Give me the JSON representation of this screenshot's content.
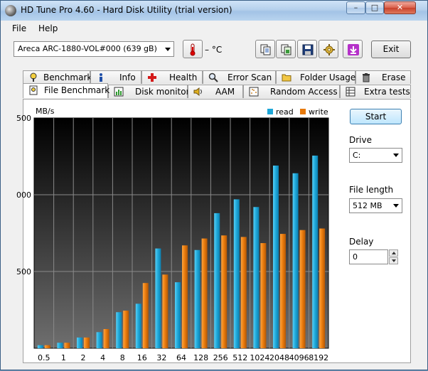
{
  "window": {
    "title": "HD Tune Pro 4.60 - Hard Disk Utility (trial version)",
    "controls": {
      "minimize": "–",
      "maximize": "□",
      "close": "✕"
    }
  },
  "menu": {
    "file": "File",
    "help": "Help"
  },
  "toolbar": {
    "drive_selected": "Areca   ARC-1880-VOL#000 (639 gB)",
    "temperature": "– °C",
    "exit_label": "Exit",
    "icons": [
      "thermometer-icon",
      "copy-text-icon",
      "copy-screenshot-icon",
      "save-icon",
      "options-icon",
      "download-icon"
    ]
  },
  "tabs": {
    "row1": [
      {
        "label": "Benchmark",
        "icon": "benchmark-icon"
      },
      {
        "label": "Info",
        "icon": "info-icon"
      },
      {
        "label": "Health",
        "icon": "health-icon"
      },
      {
        "label": "Error Scan",
        "icon": "error-scan-icon"
      },
      {
        "label": "Folder Usage",
        "icon": "folder-icon"
      },
      {
        "label": "Erase",
        "icon": "erase-icon"
      }
    ],
    "row2": [
      {
        "label": "File Benchmark",
        "icon": "file-benchmark-icon",
        "active": true
      },
      {
        "label": "Disk monitor",
        "icon": "disk-monitor-icon"
      },
      {
        "label": "AAM",
        "icon": "speaker-icon"
      },
      {
        "label": "Random Access",
        "icon": "random-access-icon"
      },
      {
        "label": "Extra tests",
        "icon": "extra-tests-icon"
      }
    ]
  },
  "side": {
    "start_label": "Start",
    "drive_label": "Drive",
    "drive_value": "C:",
    "file_length_label": "File length",
    "file_length_value": "512 MB",
    "delay_label": "Delay",
    "delay_value": "0"
  },
  "chart_data": {
    "type": "bar",
    "ylabel": "MB/s",
    "y_tick_labels": [
      "500",
      "000",
      "500"
    ],
    "y_tick_values": [
      1500,
      1000,
      500
    ],
    "ylim": [
      0,
      1500
    ],
    "categories": [
      "0.5",
      "1",
      "2",
      "4",
      "8",
      "16",
      "32",
      "64",
      "128",
      "256",
      "512",
      "1024",
      "2048",
      "4096",
      "8192"
    ],
    "series": [
      {
        "name": "read",
        "color": "#1ea7d8",
        "values": [
          20,
          36,
          70,
          105,
          235,
          290,
          650,
          430,
          640,
          880,
          970,
          920,
          1190,
          1140,
          1255
        ]
      },
      {
        "name": "write",
        "color": "#e87a0c",
        "values": [
          20,
          36,
          70,
          125,
          245,
          425,
          480,
          670,
          715,
          735,
          725,
          685,
          745,
          770,
          780
        ]
      }
    ],
    "legend_position": "top-right",
    "grid": true
  }
}
